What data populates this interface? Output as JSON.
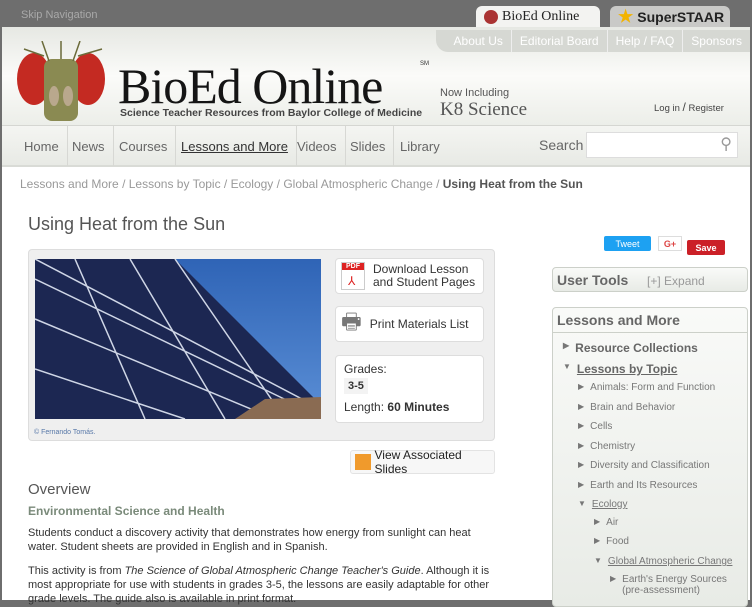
{
  "skip_nav": "Skip Navigation",
  "site_tabs": [
    "BioEd Online",
    "SuperSTAAR"
  ],
  "top_links": [
    "About Us",
    "Editorial Board",
    "Help / FAQ",
    "Sponsors"
  ],
  "logo": {
    "name": "BioEd Online",
    "sm": "SM",
    "tagline": "Science Teacher Resources from Baylor College of Medicine",
    "now_including": "Now Including",
    "k8": "K8 Science"
  },
  "auth": {
    "login": "Log in",
    "sep": "/",
    "register": "Register"
  },
  "nav": [
    "Home",
    "News",
    "Courses",
    "Lessons and More",
    "Videos",
    "Slides",
    "Library"
  ],
  "search": {
    "label": "Search",
    "placeholder": ""
  },
  "breadcrumb": [
    "Lessons and More",
    "Lessons by Topic",
    "Ecology",
    "Global Atmospheric Change"
  ],
  "breadcrumb_current": "Using Heat from the Sun",
  "title": "Using Heat from the Sun",
  "photo_credit": "© Fernando Tomás.",
  "download": {
    "icon_text": "PDF",
    "label1": "Download Lesson",
    "label2": "and Student Pages"
  },
  "print": "Print Materials List",
  "grades_label": "Grades:",
  "grades": "3-5",
  "length_label": "Length:",
  "length": "60 Minutes",
  "slides_button": "View Associated Slides",
  "overview": "Overview",
  "subject": "Environmental Science and Health",
  "para1": "Students conduct a discovery activity that demonstrates how energy from sunlight can heat water. Student sheets are provided in English and in Spanish.",
  "para2_a": "This activity is from ",
  "para2_i": "The Science of Global Atmospheric Change Teacher's Guide",
  "para2_b": ". Although it is most appropriate for use with students in grades 3-5, the lessons are easily adaptable for other grade levels. The guide also is available in print format.",
  "social": {
    "tweet": "Tweet",
    "gplus": "G+",
    "save": "Save"
  },
  "user_tools": {
    "title": "User Tools",
    "expand": "[+] Expand"
  },
  "lessons_panel": {
    "title": "Lessons and More",
    "items": [
      {
        "label": "Resource Collections"
      },
      {
        "label": "Lessons by Topic"
      },
      {
        "label": "Animals: Form and Function"
      },
      {
        "label": "Brain and Behavior"
      },
      {
        "label": "Cells"
      },
      {
        "label": "Chemistry"
      },
      {
        "label": "Diversity and Classification"
      },
      {
        "label": "Earth and Its Resources"
      },
      {
        "label": "Ecology"
      },
      {
        "label": "Air"
      },
      {
        "label": "Food"
      },
      {
        "label": "Global Atmospheric Change"
      },
      {
        "label": "Earth's Energy Sources (pre-assessment)"
      }
    ]
  }
}
